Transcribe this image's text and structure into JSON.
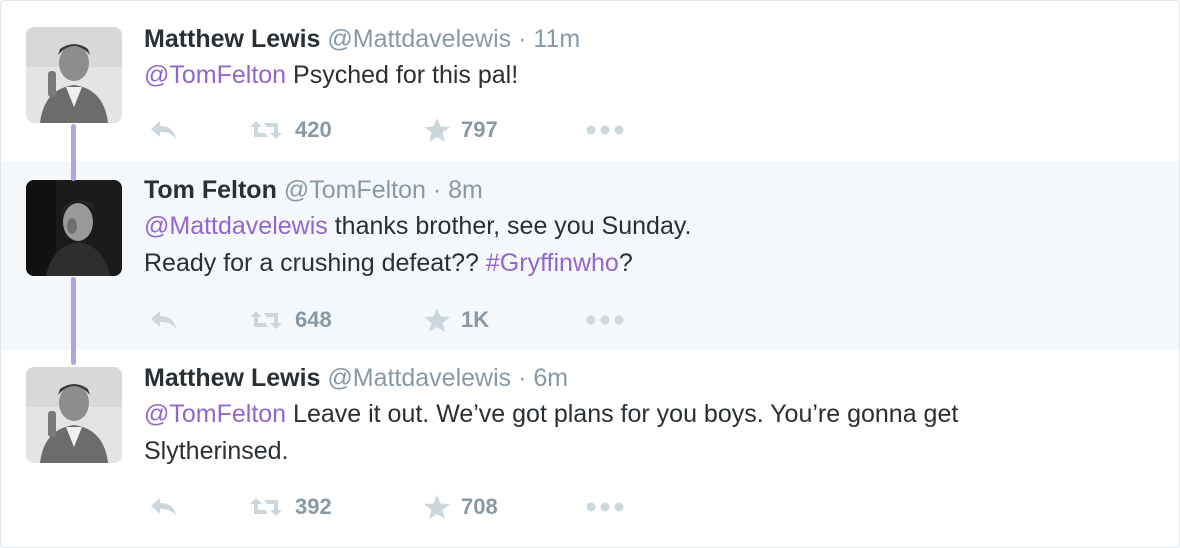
{
  "tweets": [
    {
      "name": "Matthew Lewis",
      "handle": "@Mattdavelewis",
      "separator": "·",
      "time": "11m",
      "text_lines": [
        [
          {
            "t": "@TomFelton",
            "k": "mention"
          },
          {
            "t": " Psyched for this pal!",
            "k": "plain"
          }
        ]
      ],
      "retweets": "420",
      "favorites": "797",
      "highlighted": false
    },
    {
      "name": "Tom Felton",
      "handle": "@TomFelton",
      "separator": "·",
      "time": "8m",
      "text_lines": [
        [
          {
            "t": "@Mattdavelewis",
            "k": "mention"
          },
          {
            "t": " thanks brother, see you Sunday.",
            "k": "plain"
          }
        ],
        [
          {
            "t": "Ready for a crushing defeat?? ",
            "k": "plain"
          },
          {
            "t": "#Gryffinwho",
            "k": "hashtag"
          },
          {
            "t": "?",
            "k": "plain"
          }
        ]
      ],
      "retweets": "648",
      "favorites": "1K",
      "highlighted": true
    },
    {
      "name": "Matthew Lewis",
      "handle": "@Mattdavelewis",
      "separator": "·",
      "time": "6m",
      "text_lines": [
        [
          {
            "t": "@TomFelton",
            "k": "mention"
          },
          {
            "t": " Leave it out. We’ve got plans for you boys. You’re gonna get",
            "k": "plain"
          }
        ],
        [
          {
            "t": "Slytherinsed.",
            "k": "plain"
          }
        ]
      ],
      "retweets": "392",
      "favorites": "708",
      "highlighted": false
    }
  ],
  "colors": {
    "link": "#9266cc",
    "meta": "#8899a6",
    "icon": "#ccd6dd",
    "thread_line": "#b4a3dc",
    "highlight_bg": "#f5f8fa"
  },
  "icons": {
    "reply": "reply-icon",
    "retweet": "retweet-icon",
    "favorite": "star-icon",
    "more": "more-dots-icon"
  }
}
